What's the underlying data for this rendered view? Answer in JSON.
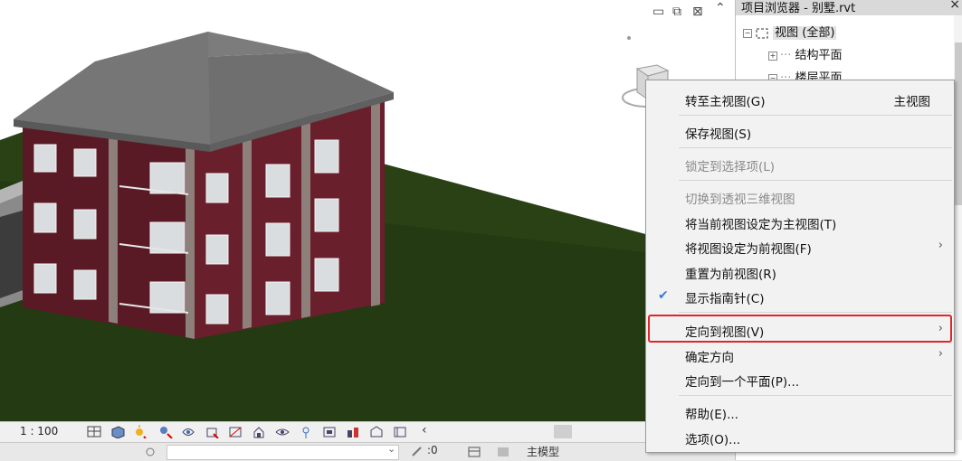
{
  "browser": {
    "title": "项目浏览器 - 别墅.rvt",
    "close": "×",
    "tree": {
      "views_all": "视图 (全部)",
      "structural_plans": "结构平面",
      "floor_plans": "楼层平面"
    }
  },
  "viewport": {
    "minimize": "▭",
    "restore": "⧉",
    "close": "⊠",
    "scroll_up": "⌃"
  },
  "viewbar": {
    "scale": "1 : 100",
    "expand": "‹"
  },
  "statusbar": {
    "zero": ":0",
    "model": "主模型"
  },
  "context_menu": {
    "items": [
      {
        "label": "转至主视图(G)",
        "shortcut": "主视图"
      },
      {
        "label": "保存视图(S)"
      },
      {
        "label": "锁定到选择项(L)"
      },
      {
        "label": "切换到透视三维视图"
      },
      {
        "label": "将当前视图设定为主视图(T)"
      },
      {
        "label": "将视图设定为前视图(F)",
        "arrow": "›"
      },
      {
        "label": "重置为前视图(R)"
      },
      {
        "label": "显示指南针(C)",
        "check": "✔"
      },
      {
        "label": "定向到视图(V)",
        "arrow": "›"
      },
      {
        "label": "确定方向",
        "arrow": "›"
      },
      {
        "label": "定向到一个平面(P)..."
      },
      {
        "label": "帮助(E)..."
      },
      {
        "label": "选项(O)..."
      }
    ]
  },
  "colors": {
    "ground": "#243a12",
    "wall": "#5c1a26",
    "roof": "#6f6f6f",
    "highlight": "#e0262a"
  },
  "icons": [
    "cube-icon",
    "home-icon",
    "hide-icon",
    "section-box-icon",
    "render-icon",
    "crop-icon"
  ]
}
